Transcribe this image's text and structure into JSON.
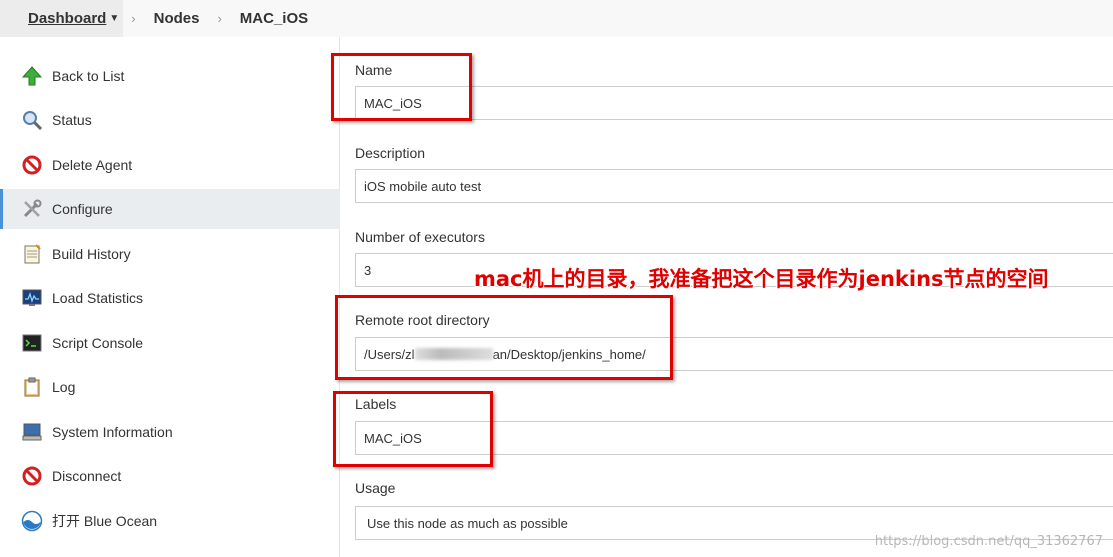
{
  "breadcrumb": {
    "dashboard": "Dashboard",
    "nodes": "Nodes",
    "current": "MAC_iOS",
    "separator": "›"
  },
  "sidebar": {
    "items": [
      {
        "label": "Back to List",
        "icon": "up-arrow-icon"
      },
      {
        "label": "Status",
        "icon": "magnifier-icon"
      },
      {
        "label": "Delete Agent",
        "icon": "no-entry-icon"
      },
      {
        "label": "Configure",
        "icon": "wrench-screwdriver-icon"
      },
      {
        "label": "Build History",
        "icon": "notepad-icon"
      },
      {
        "label": "Load Statistics",
        "icon": "monitor-graph-icon"
      },
      {
        "label": "Script Console",
        "icon": "terminal-icon"
      },
      {
        "label": "Log",
        "icon": "clipboard-icon"
      },
      {
        "label": "System Information",
        "icon": "computer-icon"
      },
      {
        "label": "Disconnect",
        "icon": "no-entry-icon"
      },
      {
        "label": "打开 Blue Ocean",
        "icon": "blue-ocean-icon"
      }
    ],
    "active_index": 3
  },
  "form": {
    "name_label": "Name",
    "name_value": "MAC_iOS",
    "description_label": "Description",
    "description_value": "iOS mobile auto test",
    "executors_label": "Number of executors",
    "executors_value": "3",
    "remote_root_label": "Remote root directory",
    "remote_root_prefix": "/Users/zl",
    "remote_root_suffix": "an/Desktop/jenkins_home/",
    "labels_label": "Labels",
    "labels_value": "MAC_iOS",
    "usage_label": "Usage",
    "usage_value": "Use this node as much as possible"
  },
  "annotation": {
    "bold_prefix": "mac",
    "text_middle": "机上的目录，我准备把这个目录作为",
    "bold_word": "jenkins",
    "text_end": "节点的空间"
  },
  "watermark": "https://blog.csdn.net/qq_31362767",
  "colors": {
    "annotation_red": "#e00000",
    "active_accent": "#4a90d9"
  }
}
